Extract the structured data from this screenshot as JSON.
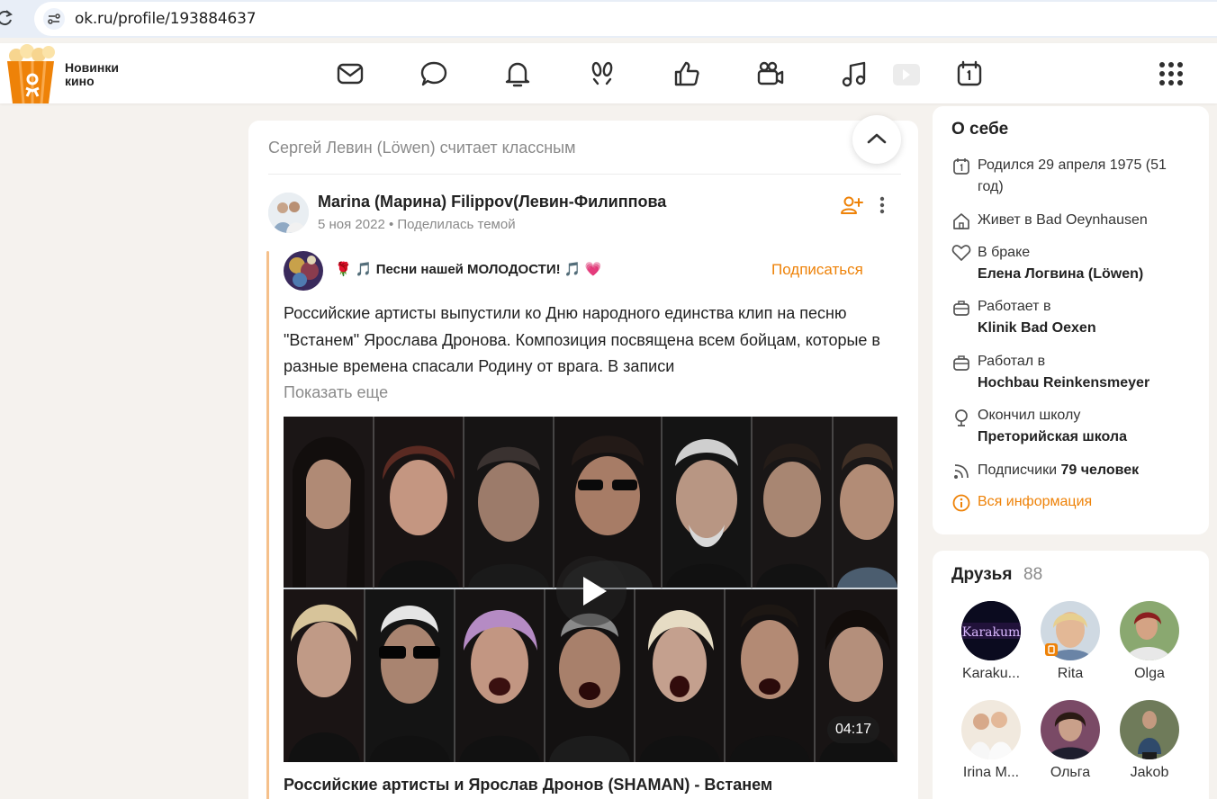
{
  "browser": {
    "url": "ok.ru/profile/193884637"
  },
  "topbar": {
    "brand_line1": "Новинки",
    "brand_line2": "кино",
    "nav_icons": [
      "mail-icon",
      "chat-icon",
      "bell-icon",
      "footprints-icon",
      "thumbs-up-icon",
      "video-camera-icon",
      "music-icon",
      "video-play-icon",
      "calendar-icon",
      "apps-grid-icon"
    ]
  },
  "feed": {
    "header": "Сергей Левин (Löwen) считает классным",
    "post": {
      "author": "Marina (Марина) Filippov(Левин-Филиппова",
      "date": "5 ноя 2022",
      "action": "Поделилась темой",
      "group": {
        "prefix": "🌹 🎵",
        "name": "Песни нашей МОЛОДОСТИ!",
        "suffix": "🎵 💗",
        "subscribe_label": "Подписаться"
      },
      "text": "Российские артисты выпустили ко Дню народного единства клип на песню \"Встанем\" Ярослава Дронова.  Композиция посвящена всем бойцам, которые в разные времена спасали Родину от врага. В записи",
      "show_more": "Показать еще",
      "video": {
        "duration": "04:17",
        "title": "Российские артисты и Ярослав Дронов (SHAMAN)  - Встанем"
      }
    }
  },
  "about": {
    "title": "О себе",
    "born": "Родился 29 апреля 1975 (51 год)",
    "lives_label": "Живет в",
    "lives_value": "Bad Oeynhausen",
    "married_label": "В браке",
    "married_value": "Елена Логвина (Löwen)",
    "works_label": "Работает в",
    "works_value": "Klinik Bad Oexen",
    "worked_label": "Работал в",
    "worked_value": "Hochbau Reinkensmeyer",
    "school_label": "Окончил школу",
    "school_value": "Преторийская школа",
    "followers_label": "Подписчики",
    "followers_value": "79 человек",
    "all_info": "Вся информация"
  },
  "friends": {
    "title": "Друзья",
    "count": "88",
    "list": [
      {
        "name": "Karaku...",
        "avatar_text": "Karakum"
      },
      {
        "name": "Rita"
      },
      {
        "name": "Olga"
      },
      {
        "name": "Irina M..."
      },
      {
        "name": "Ольга"
      },
      {
        "name": "Jakob"
      }
    ]
  },
  "colors": {
    "accent": "#ee8208",
    "page_bg": "#f5f2ee",
    "card_bg": "#ffffff"
  }
}
